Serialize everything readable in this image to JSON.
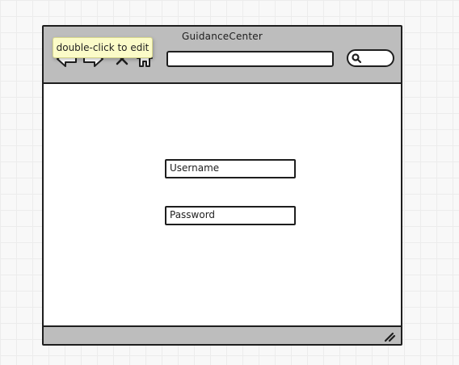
{
  "window": {
    "title": "GuidanceCenter"
  },
  "toolbar": {
    "icons": [
      "back-arrow-icon",
      "forward-arrow-icon",
      "close-icon",
      "home-icon"
    ],
    "address_value": "",
    "search_icon": "search-icon"
  },
  "login": {
    "username_placeholder": "Username",
    "password_placeholder": "Password"
  },
  "tooltip": {
    "text": "double-click to edit"
  },
  "colors": {
    "chrome": "#bdbdbd",
    "outline": "#1e1e1e",
    "content": "#ffffff",
    "tooltip_background": "#fbfbc8"
  }
}
